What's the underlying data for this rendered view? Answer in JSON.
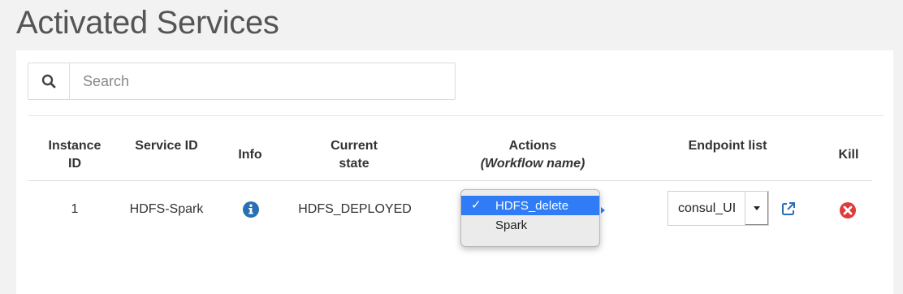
{
  "page": {
    "title": "Activated Services"
  },
  "search": {
    "placeholder": "Search",
    "value": "",
    "icon": "search-icon"
  },
  "table": {
    "headers": {
      "instance_id": "Instance ID",
      "service_id": "Service ID",
      "info": "Info",
      "current_state": "Current state",
      "actions": "Actions",
      "actions_sub": "(Workflow name)",
      "endpoint_list": "Endpoint list",
      "kill": "Kill"
    },
    "rows": [
      {
        "instance_id": "1",
        "service_id": "HDFS-Spark",
        "info_icon": "info-circle-icon",
        "current_state": "HDFS_DEPLOYED",
        "actions": {
          "selected": "HDFS_delete",
          "options": [
            "HDFS_delete",
            "Spark"
          ],
          "open": true
        },
        "endpoint": {
          "selected": "consul_UI"
        },
        "external_link_icon": "external-link-icon",
        "kill_icon": "times-circle-icon"
      }
    ]
  },
  "colors": {
    "accent": "#2f7cf6",
    "info_icon": "#2a6fb4",
    "kill_icon": "#e03b3b",
    "background": "#f2f2f2"
  }
}
